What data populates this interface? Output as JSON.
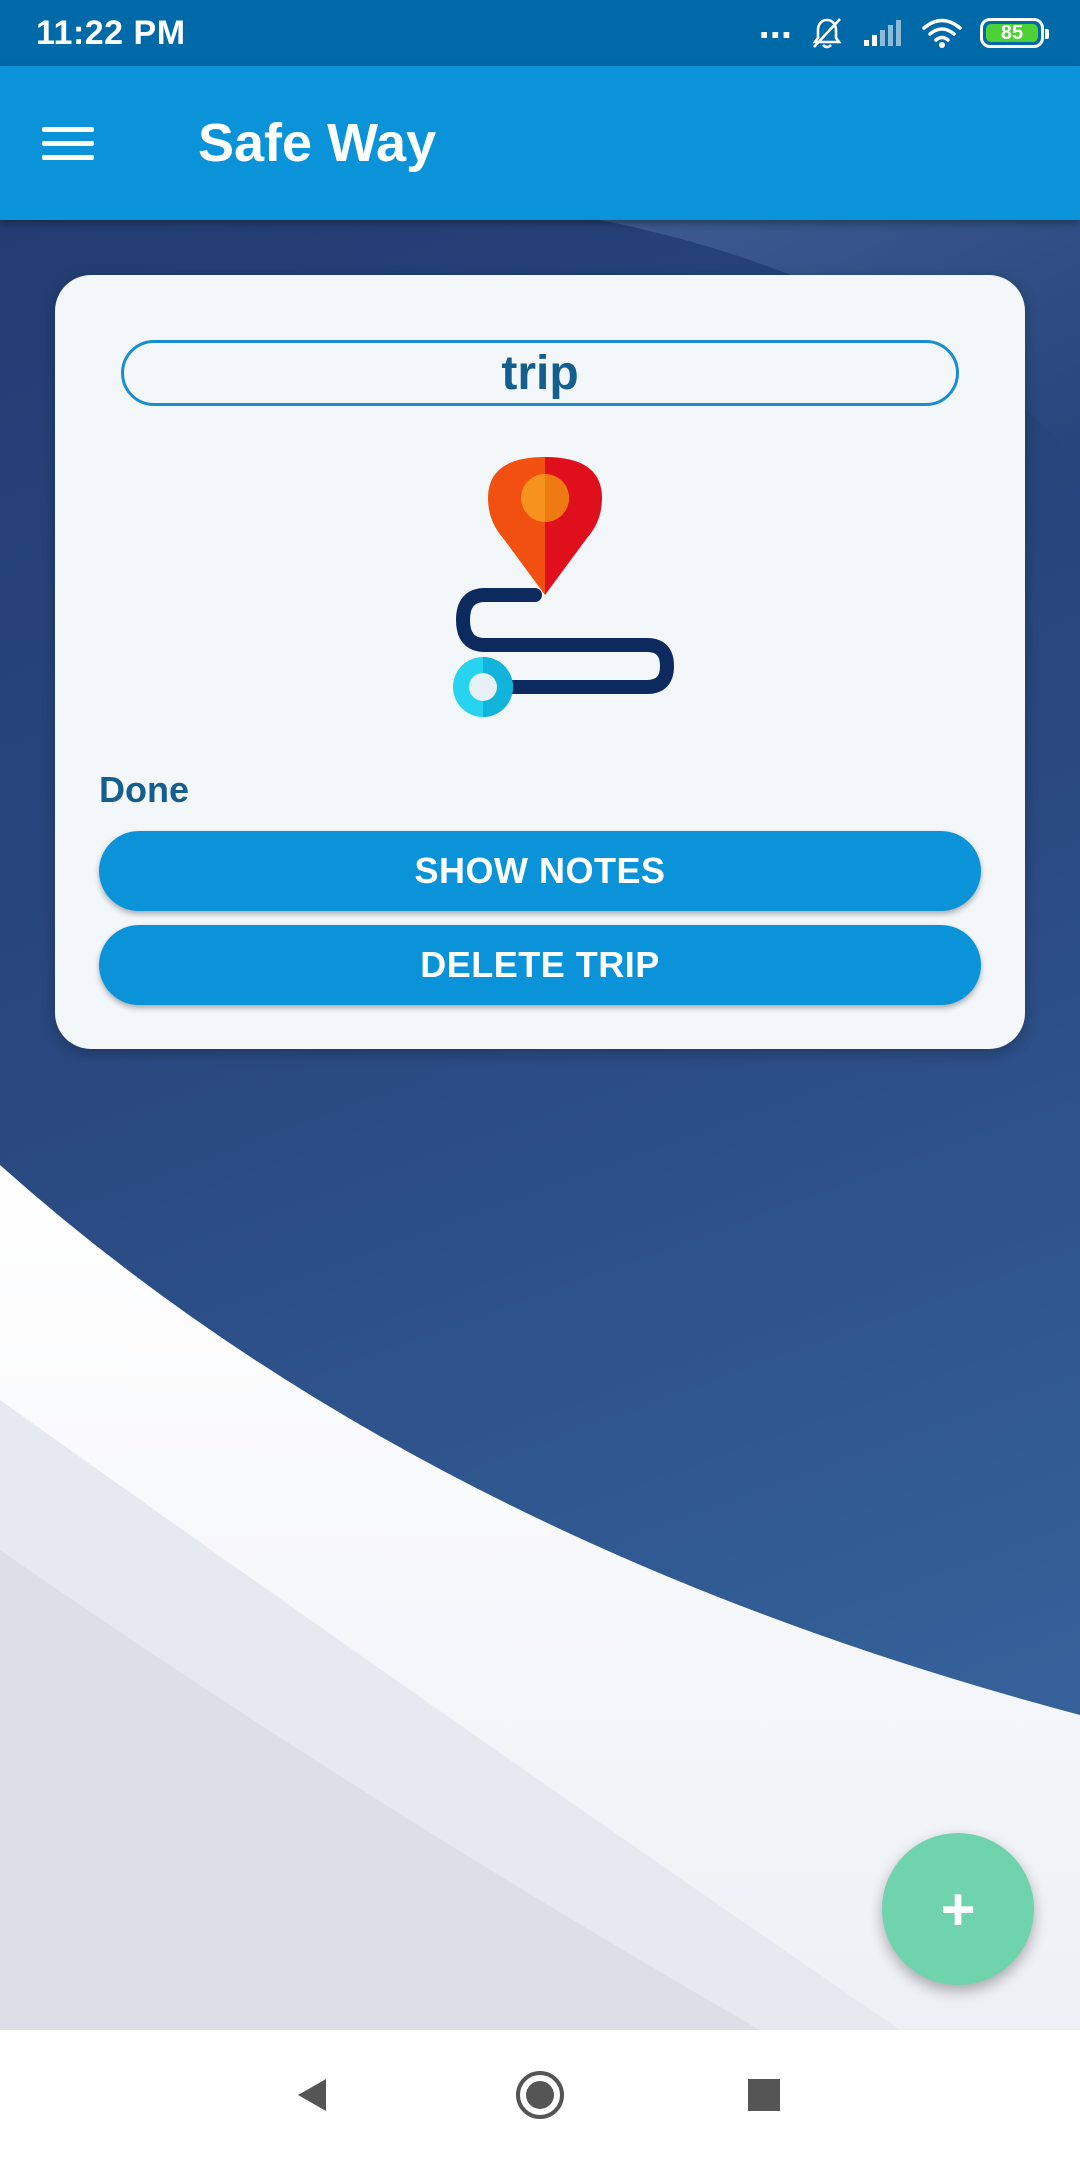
{
  "status_bar": {
    "time": "11:22 PM",
    "dots": "...",
    "battery": "85"
  },
  "app_bar": {
    "title": "Safe Way",
    "menu_icon": "hamburger-menu-icon"
  },
  "trip_card": {
    "name": "trip",
    "status": "Done",
    "show_notes_label": "SHOW NOTES",
    "delete_trip_label": "DELETE TRIP",
    "illustration_icon": "route-map-pin-icon"
  },
  "fab": {
    "label": "+",
    "icon": "add-icon"
  },
  "nav_bar": {
    "back_icon": "back-triangle-icon",
    "home_icon": "home-circle-icon",
    "recents_icon": "recents-square-icon"
  },
  "colors": {
    "status_bar": "#0069a8",
    "app_bar": "#0a93d9",
    "button": "#0a93d9",
    "fab": "#6fd3ad",
    "card_text": "#155f8e",
    "background_dark": "#233d72"
  }
}
